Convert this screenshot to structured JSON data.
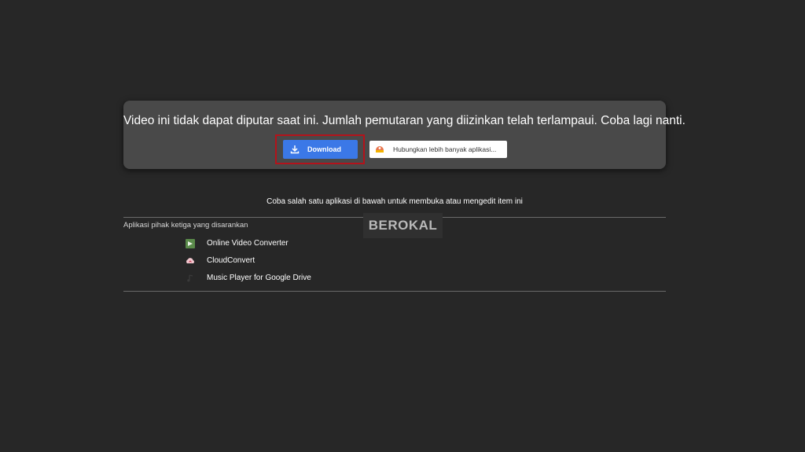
{
  "error_card": {
    "message": "Video ini tidak dapat diputar saat ini. Jumlah pemutaran yang diizinkan telah terlampaui. Coba lagi nanti.",
    "download_label": "Download",
    "download_icon": "download-icon",
    "connect_label": "Hubungkan lebih banyak aplikasi...",
    "connect_icon": "apps-marketplace-icon"
  },
  "open_with": {
    "prompt": "Coba salah satu aplikasi di bawah untuk membuka atau mengedit item ini",
    "section_title": "Aplikasi pihak ketiga yang disarankan",
    "apps": [
      {
        "label": "Online Video Converter",
        "icon": "online-video-converter-icon"
      },
      {
        "label": "CloudConvert",
        "icon": "cloudconvert-icon"
      },
      {
        "label": "Music Player for Google Drive",
        "icon": "music-player-icon"
      }
    ]
  },
  "watermark": {
    "text": "BEROKAL"
  },
  "colors": {
    "background": "#272727",
    "card": "#494949",
    "accent_blue": "#3b78e7",
    "highlight_red": "#b3131b"
  }
}
